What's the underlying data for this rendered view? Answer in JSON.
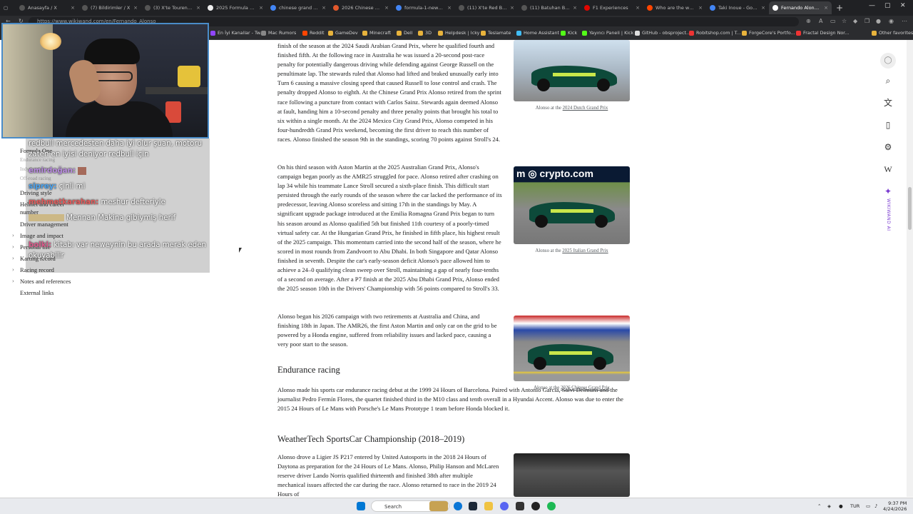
{
  "browser": {
    "tabs": [
      {
        "title": "Anasayfa / X",
        "color": "#555555"
      },
      {
        "title": "(7) Bildirimler / X",
        "color": "#555555"
      },
      {
        "title": "(3) X'te Tourens: \"",
        "color": "#555555"
      },
      {
        "title": "2025 Formula One Wo",
        "color": "#eeeeee"
      },
      {
        "title": "chinese grand prix tick",
        "color": "#4285f4"
      },
      {
        "title": "2026 Chinese Grand P",
        "color": "#e2582c"
      },
      {
        "title": "formula-1-news-2026",
        "color": "#4285f4"
      },
      {
        "title": "(11) X'te Red Bull Türk",
        "color": "#555555"
      },
      {
        "title": "(11) Batuhan Bozkan (",
        "color": "#555555"
      },
      {
        "title": "F1 Experiences",
        "color": "#e10600"
      },
      {
        "title": "Who are the worst dri",
        "color": "#ff4500"
      },
      {
        "title": "Taki Inoue - Google S",
        "color": "#4285f4"
      },
      {
        "title": "Fernando Alonso - Wi",
        "color": "#ffffff"
      }
    ],
    "new_tab": "+",
    "url": "https://www.wikiwand.com/en/Fernando_Alonso",
    "bookmarks": [
      "En İyi Kanallar - Tw...",
      "Mac Rumors",
      "Reddit",
      "GameDev",
      "Minecraft",
      "Dell",
      "3D",
      "Helpdesk | Icky",
      "Teslamate",
      "Home Assistant",
      "Kick",
      "Yayıncı Paneli | Kick",
      "GitHub - obsproject...",
      "Robitshop.com | T...",
      "ForgeCore's Portfo...",
      "Fractal Design Nor..."
    ],
    "other_favorites": "Other favorites"
  },
  "sidebar": {
    "items": [
      {
        "label": "Formula One",
        "sub": false,
        "chev": false
      },
      {
        "label": "Endurance racing",
        "sub": true,
        "chev": false
      },
      {
        "label": "IndyCar Series",
        "sub": true,
        "chev": false
      },
      {
        "label": "Off-road racing",
        "sub": true,
        "chev": false
      },
      {
        "label": "Driving style",
        "sub": false,
        "chev": false
      },
      {
        "label": "Helmet and career number",
        "sub": false,
        "chev": false
      },
      {
        "label": "Driver management",
        "sub": false,
        "chev": false
      },
      {
        "label": "Image and impact",
        "sub": false,
        "chev": true
      },
      {
        "label": "Personal life",
        "sub": false,
        "chev": true
      },
      {
        "label": "Karting record",
        "sub": false,
        "chev": true
      },
      {
        "label": "Racing record",
        "sub": false,
        "chev": true
      },
      {
        "label": "Notes and references",
        "sub": false,
        "chev": true
      },
      {
        "label": "External links",
        "sub": false,
        "chev": false
      }
    ]
  },
  "chat": [
    {
      "nick": "",
      "color": "#ffffff",
      "text": "redbull mercedesten daha iyi olur şuan, motoru zaten en iyisi deniyor redbull için"
    },
    {
      "nick": "emirdoğan:",
      "color": "#b98be0",
      "text": ""
    },
    {
      "nick": "siprey:",
      "color": "#4aa3f0",
      "text": "çinli mi"
    },
    {
      "nick": "mehmetkarahan:",
      "color": "#e05a5a",
      "text": "meshur defteriyle"
    },
    {
      "nick": "",
      "color": "#ffffff",
      "text": "Mennan Makina gibiymiş herif"
    },
    {
      "nick": "bolki:",
      "color": "#d95a8a",
      "text": "kitabı var neweynin bu arada merak eden okuyabilir"
    }
  ],
  "article": {
    "p1": "finish of the season at the 2024 Saudi Arabian Grand Prix, where he qualified fourth and finished fifth. At the following race in Australia he was issued a 20-second post-race penalty for potentially dangerous driving while defending against George Russell on the penultimate lap. The stewards ruled that Alonso had lifted and braked unusually early into Turn 6 causing a massive closing speed that caused Russell to lose control and crash. The penalty dropped Alonso to eighth. At the Chinese Grand Prix Alonso retired from the sprint race following a puncture from contact with Carlos Sainz. Stewards again deemed Alonso at fault, handing him a 10-second penalty and three penalty points that brought his total to six within a single month. At the 2024 Mexico City Grand Prix, Alonso competed in his four-hundredth Grand Prix weekend, becoming the first driver to reach this number of races. Alonso finished the season 9th in the standings, scoring 70 points against Stroll's 24.",
    "p2": "On his third season with Aston Martin at the 2025 Australian Grand Prix, Alonso's campaign began poorly as the AMR25 struggled for pace. Alonso retired after crashing on lap 34 while his teammate Lance Stroll secured a sixth-place finish. This difficult start persisted through the early rounds of the season where the car lacked the performance of its predecessor, leaving Alonso scoreless and sitting 17th in the standings by May. A significant upgrade package introduced at the Emilia Romagna Grand Prix began to turn his season around as Alonso qualified 5th but finished 11th courtesy of a poorly-timed virtual safety car. At the Hungarian Grand Prix, he finished in fifth place, his highest result of the 2025 campaign. This momentum carried into the second half of the season, where he scored in most rounds from Zandvoort to Abu Dhabi. In both Singapore and Qatar Alonso finished in seventh. Despite the car's early-season deficit Alonso's pace allowed him to achieve a 24–0 qualifying clean sweep over Stroll, maintaining a gap of nearly four-tenths of a second on average. After a P7 finish at the 2025 Abu Dhabi Grand Prix, Alonso ended the 2025 season 10th in the Drivers' Championship with 56 points compared to Stroll's 33.",
    "p3": "Alonso began his 2026 campaign with two retirements at Australia and China, and finishing 18th in Japan. The AMR26, the first Aston Martin and only car on the grid to be powered by a Honda engine, suffered from reliability issues and lacked pace, causing a very poor start to the season.",
    "h_endurance": "Endurance racing",
    "p4": "Alonso made his sports car endurance racing debut at the 1999 24 Hours of Barcelona. Paired with Antonio García, Salvi Delmuns and the journalist Pedro Fermín Flores, the quartet finished third in the M10 class and tenth overall in a Hyundai Accent. Alonso was due to enter the 2015 24 Hours of Le Mans with Porsche's Le Mans Prototype 1 team before Honda blocked it.",
    "h_weathertech": "WeatherTech SportsCar Championship (2018–2019)",
    "p5": "Alonso drove a Ligier JS P217 entered by United Autosports in the 2018 24 Hours of Daytona as preparation for the 24 Hours of Le Mans. Alonso, Philip Hanson and McLaren reserve driver Lando Norris qualified thirteenth and finished 38th after multiple mechanical issues affected the car during the race. Alonso returned to race in the 2019 24 Hours of"
  },
  "figures": [
    {
      "caption_prefix": "Alonso at the ",
      "caption_link": "2024 Dutch Grand Prix"
    },
    {
      "caption_prefix": "Alonso at the ",
      "caption_link": "2025 Italian Grand Prix",
      "banner": "crypto.com"
    },
    {
      "caption_prefix": "Alonso at the ",
      "caption_link": "2026 Chinese Grand Prix"
    }
  ],
  "right_toolbar": {
    "ai_label": "WIKIWAND AI",
    "accent": "#7a3bd0"
  },
  "taskbar": {
    "search_placeholder": "Search",
    "lang": "TUR",
    "time": "9:37 PM",
    "date": "4/24/2026"
  }
}
